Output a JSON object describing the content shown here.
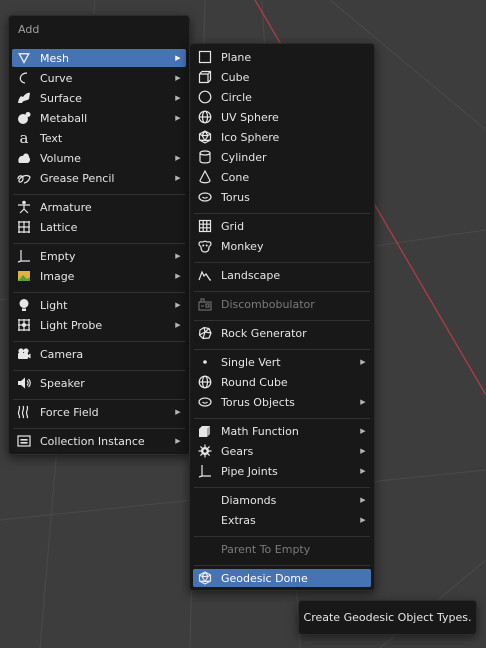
{
  "add_menu": {
    "title": "Add",
    "items": [
      {
        "label": "Mesh",
        "icon": "mesh-icon",
        "submenu": true,
        "active": true
      },
      {
        "label": "Curve",
        "icon": "curve-icon",
        "submenu": true
      },
      {
        "label": "Surface",
        "icon": "surface-icon",
        "submenu": true
      },
      {
        "label": "Metaball",
        "icon": "metaball-icon",
        "submenu": true
      },
      {
        "label": "Text",
        "icon": "text-icon",
        "submenu": false
      },
      {
        "label": "Volume",
        "icon": "volume-icon",
        "submenu": true
      },
      {
        "label": "Grease Pencil",
        "icon": "grease-pencil-icon",
        "submenu": true
      },
      {
        "label": "Armature",
        "icon": "armature-icon",
        "submenu": false
      },
      {
        "label": "Lattice",
        "icon": "lattice-icon",
        "submenu": false
      },
      {
        "label": "Empty",
        "icon": "empty-icon",
        "submenu": true
      },
      {
        "label": "Image",
        "icon": "image-icon",
        "submenu": true
      },
      {
        "label": "Light",
        "icon": "light-icon",
        "submenu": true
      },
      {
        "label": "Light Probe",
        "icon": "light-probe-icon",
        "submenu": true
      },
      {
        "label": "Camera",
        "icon": "camera-icon",
        "submenu": false
      },
      {
        "label": "Speaker",
        "icon": "speaker-icon",
        "submenu": false
      },
      {
        "label": "Force Field",
        "icon": "force-field-icon",
        "submenu": true
      },
      {
        "label": "Collection Instance",
        "icon": "collection-icon",
        "submenu": true
      }
    ]
  },
  "mesh_menu": {
    "items": [
      {
        "label": "Plane",
        "icon": "plane-icon"
      },
      {
        "label": "Cube",
        "icon": "cube-icon"
      },
      {
        "label": "Circle",
        "icon": "circle-icon"
      },
      {
        "label": "UV Sphere",
        "icon": "uv-sphere-icon"
      },
      {
        "label": "Ico Sphere",
        "icon": "ico-sphere-icon"
      },
      {
        "label": "Cylinder",
        "icon": "cylinder-icon"
      },
      {
        "label": "Cone",
        "icon": "cone-icon"
      },
      {
        "label": "Torus",
        "icon": "torus-icon"
      },
      {
        "label": "Grid",
        "icon": "grid-icon"
      },
      {
        "label": "Monkey",
        "icon": "monkey-icon"
      },
      {
        "label": "Landscape",
        "icon": "landscape-icon"
      },
      {
        "label": "Discombobulator",
        "icon": "discombobulator-icon",
        "disabled": true
      },
      {
        "label": "Rock Generator",
        "icon": "rock-generator-icon"
      },
      {
        "label": "Single Vert",
        "icon": "single-vert-icon",
        "submenu": true
      },
      {
        "label": "Round Cube",
        "icon": "round-cube-icon"
      },
      {
        "label": "Torus Objects",
        "icon": "torus-objects-icon",
        "submenu": true
      },
      {
        "label": "Math Function",
        "icon": "math-function-icon",
        "submenu": true
      },
      {
        "label": "Gears",
        "icon": "gears-icon",
        "submenu": true
      },
      {
        "label": "Pipe Joints",
        "icon": "pipe-joints-icon",
        "submenu": true
      },
      {
        "label": "Diamonds",
        "icon": "",
        "submenu": true
      },
      {
        "label": "Extras",
        "icon": "",
        "submenu": true
      },
      {
        "label": "Parent To Empty",
        "icon": "",
        "disabled": true
      },
      {
        "label": "Geodesic Dome",
        "icon": "geodesic-dome-icon",
        "active": true
      }
    ]
  },
  "tooltip": {
    "text": "Create Geodesic Object Types."
  },
  "colors": {
    "menu_bg": "#181818",
    "highlight": "#4772b3",
    "viewport_bg": "#3d3d3d",
    "axis_x": "#b23a48"
  }
}
